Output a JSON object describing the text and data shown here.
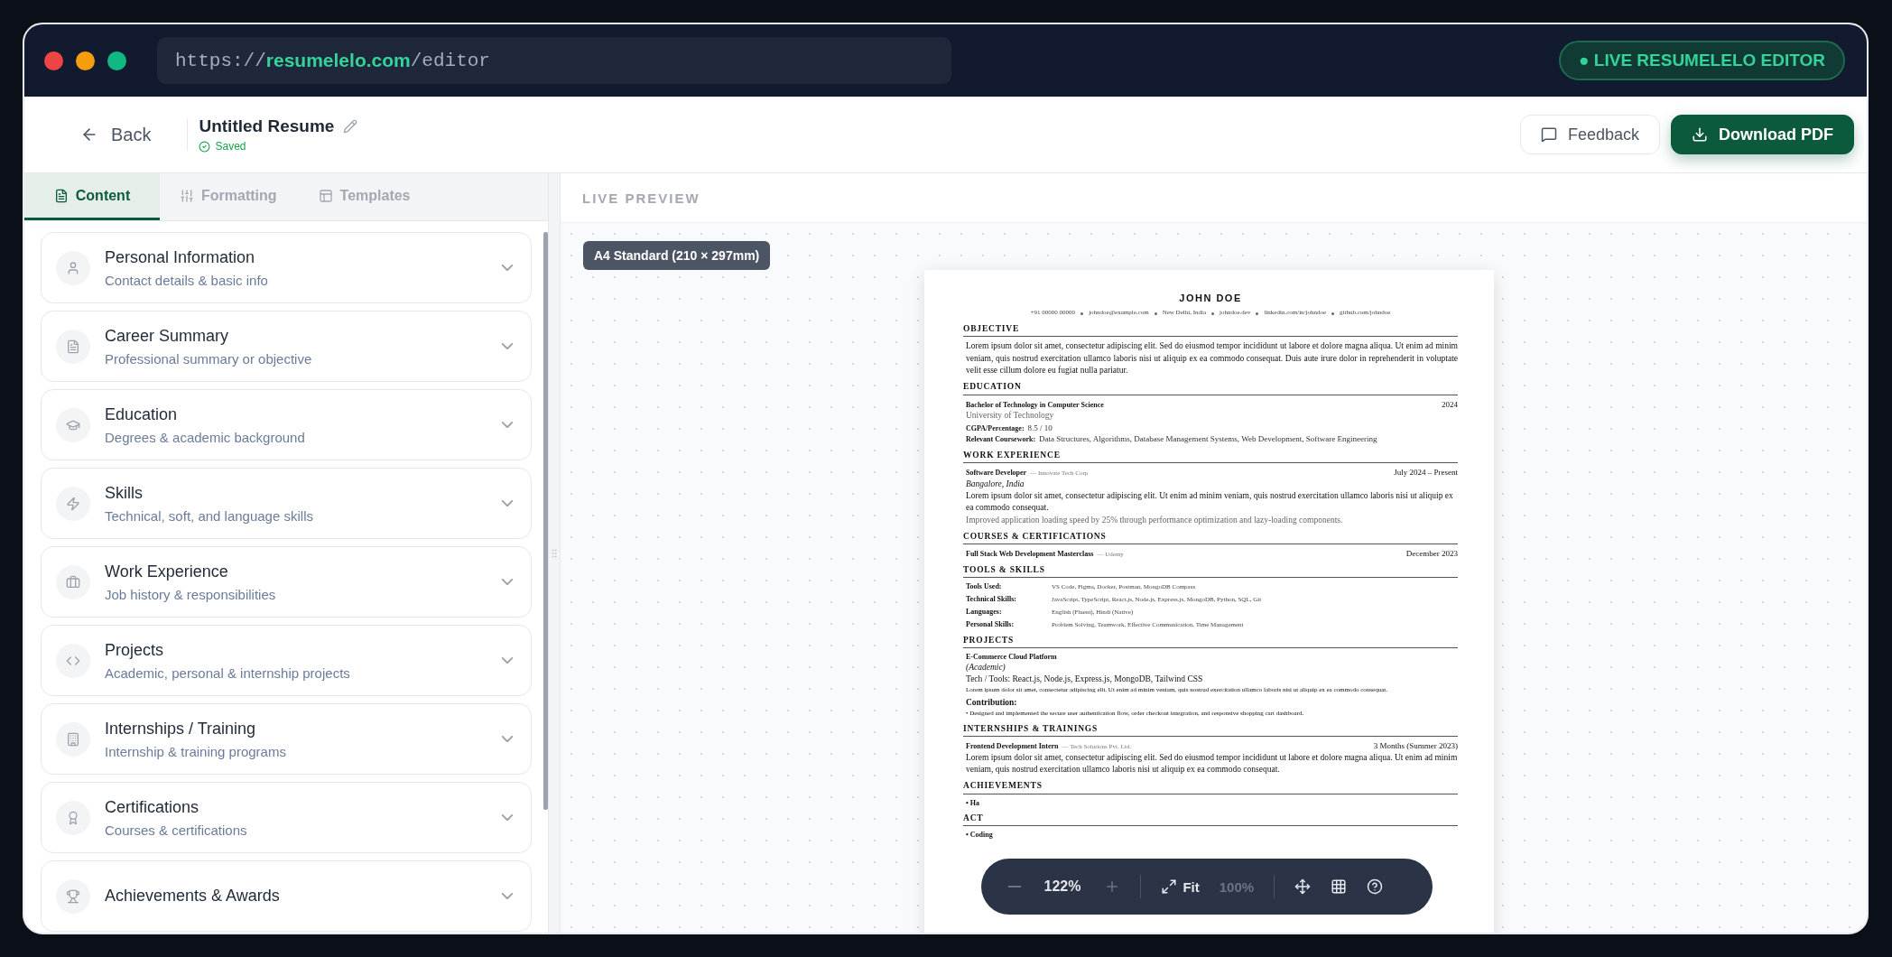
{
  "browser": {
    "url": {
      "scheme": "https://",
      "domain": "resumelelo.com",
      "path": "/editor"
    },
    "badge": "● LIVE RESUMELELO EDITOR"
  },
  "header": {
    "back": "Back",
    "title": "Untitled Resume",
    "status": "Saved",
    "buttons": [
      {
        "label": "Feedback",
        "kind": "secondary"
      },
      {
        "label": "Download PDF",
        "kind": "primary"
      }
    ]
  },
  "tabs": [
    {
      "label": "Content",
      "selected": true
    },
    {
      "label": "Formatting",
      "selected": false
    },
    {
      "label": "Templates",
      "selected": false
    }
  ],
  "sections": [
    {
      "title": "Personal Information",
      "subtitle": "Contact details & basic info"
    },
    {
      "title": "Career Summary",
      "subtitle": "Professional summary or objective"
    },
    {
      "title": "Education",
      "subtitle": "Degrees & academic background"
    },
    {
      "title": "Skills",
      "subtitle": "Technical, soft, and language skills"
    },
    {
      "title": "Work Experience",
      "subtitle": "Job history & responsibilities"
    },
    {
      "title": "Projects",
      "subtitle": "Academic, personal & internship projects"
    },
    {
      "title": "Internships / Training",
      "subtitle": "Internship & training programs"
    },
    {
      "title": "Certifications",
      "subtitle": "Courses & certifications"
    },
    {
      "title": "Achievements & Awards"
    }
  ],
  "preview": {
    "label": "LIVE PREVIEW",
    "page_size": "A4 Standard (210 × 297mm)",
    "resume": {
      "name": "JOHN DOE",
      "contact": [
        "+91 00000 00000",
        "johndoe@example.com",
        "New Delhi, India",
        "johndoe.dev",
        "linkedin.com/in/johndoe",
        "github.com/johndoe"
      ],
      "blocks": [
        {
          "kind": "paragraph",
          "heading": "OBJECTIVE",
          "text": "Lorem ipsum dolor sit amet, consectetur adipiscing elit. Sed do eiusmod tempor incididunt ut labore et dolore magna aliqua. Ut enim ad minim veniam, quis nostrud exercitation ullamco laboris nisi ut aliquip ex ea commodo consequat. Duis aute irure dolor in reprehenderit in voluptate velit esse cillum dolore eu fugiat nulla pariatur."
        },
        {
          "kind": "entries",
          "heading": "EDUCATION",
          "entries": [
            {
              "title": "Bachelor of Technology in Computer Science",
              "date": "2024",
              "lines": [
                {
                  "kind": "muted",
                  "text": "University of Technology"
                },
                {
                  "kind": "field",
                  "label": "CGPA/Percentage:",
                  "text": "8.5 / 10"
                },
                {
                  "kind": "field",
                  "label": "Relevant Coursework:",
                  "text": "Data Structures, Algorithms, Database Management Systems, Web Development, Software Engineering"
                }
              ]
            }
          ]
        },
        {
          "kind": "entries",
          "heading": "WORK EXPERIENCE",
          "entries": [
            {
              "title": "Software Developer",
              "org": "— Innovate Tech Corp",
              "date": "July 2024 – Present",
              "lines": [
                {
                  "kind": "italic",
                  "text": "Bangalore, India"
                },
                {
                  "kind": "text",
                  "text": "Lorem ipsum dolor sit amet, consectetur adipiscing elit. Ut enim ad minim veniam, quis nostrud exercitation ullamco laboris nisi ut aliquip ex ea commodo consequat."
                },
                {
                  "kind": "muted",
                  "text": "Improved application loading speed by 25% through performance optimization and lazy-loading components."
                }
              ]
            }
          ]
        },
        {
          "kind": "entries",
          "heading": "COURSES & CERTIFICATIONS",
          "entries": [
            {
              "title": "Full Stack Web Development Masterclass",
              "org": "— Udemy",
              "date": "December 2023"
            }
          ]
        },
        {
          "kind": "skills",
          "heading": "TOOLS & SKILLS",
          "rows": [
            {
              "label": "Tools Used:",
              "text": "VS Code, Figma, Docker, Postman, MongoDB Compass"
            },
            {
              "label": "Technical Skills:",
              "text": "JavaScript, TypeScript, React.js, Node.js, Express.js, MongoDB, Python, SQL, Git"
            },
            {
              "label": "Languages:",
              "text": "English (Fluent), Hindi (Native)"
            },
            {
              "label": "Personal Skills:",
              "text": "Problem Solving, Teamwork, Effective Communication, Time Management"
            }
          ]
        },
        {
          "kind": "entries",
          "heading": "PROJECTS",
          "entries": [
            {
              "title": "E-Commerce Cloud Platform",
              "lines": [
                {
                  "kind": "italic",
                  "text": "(Academic)"
                },
                {
                  "kind": "text",
                  "text": "Tech / Tools: React.js, Node.js, Express.js, MongoDB, Tailwind CSS"
                },
                {
                  "kind": "small",
                  "text": "Lorem ipsum dolor sit amet, consectetur adipiscing elit. Ut enim ad minim veniam, quis nostrud exercitation ullamco laboris nisi ut aliquip ex ea commodo consequat."
                },
                {
                  "kind": "heading",
                  "text": "Contribution:"
                },
                {
                  "kind": "bullet",
                  "text": "• Designed and implemented the secure user authentication flow, order checkout integration, and responsive shopping cart dashboard."
                }
              ]
            }
          ]
        },
        {
          "kind": "entries",
          "heading": "INTERNSHIPS & TRAININGS",
          "entries": [
            {
              "title": "Frontend Development Intern",
              "org": "— Tech Solutions Pvt. Ltd.",
              "date": "3 Months (Summer 2023)",
              "lines": [
                {
                  "kind": "text",
                  "text": "Lorem ipsum dolor sit amet, consectetur adipiscing elit. Sed do eiusmod tempor incididunt ut labore et dolore magna aliqua. Ut enim ad minim veniam, quis nostrud exercitation ullamco laboris nisi ut aliquip ex ea commodo consequat."
                }
              ]
            }
          ]
        },
        {
          "kind": "list",
          "heading": "ACHIEVEMENTS",
          "items": [
            "• Ha"
          ]
        },
        {
          "kind": "list",
          "heading": "ACT",
          "items": [
            "• Coding"
          ]
        }
      ]
    },
    "zoom": {
      "zoom_text": "122%",
      "fit": "Fit",
      "actual": "100%"
    }
  }
}
